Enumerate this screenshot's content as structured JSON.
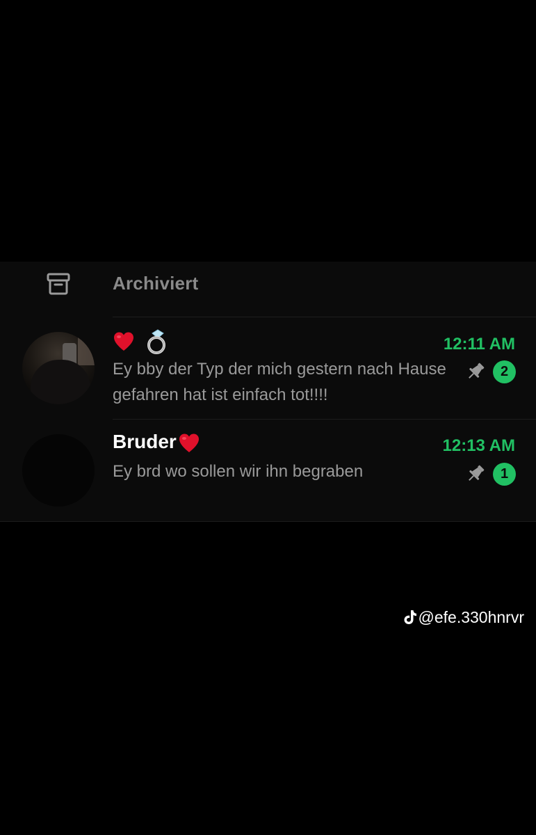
{
  "archived": {
    "label": "Archiviert",
    "icon": "archive-icon"
  },
  "chats": [
    {
      "name": "",
      "name_emojis": [
        "red-heart-emoji",
        "ring-emoji"
      ],
      "time": "12:11 AM",
      "preview": "Ey bby der Typ der mich gestern nach Hause gefahren hat ist einfach tot!!!!",
      "pinned": true,
      "unread": "2"
    },
    {
      "name": "Bruder",
      "name_emojis": [
        "red-heart-emoji"
      ],
      "time": "12:13 AM",
      "preview": "Ey brd wo sollen wir ihn begraben",
      "pinned": true,
      "unread": "1"
    }
  ],
  "watermark": {
    "handle": "@efe.330hnrvr",
    "icon": "tiktok-icon"
  },
  "colors": {
    "accent_green": "#21c063",
    "background": "#000000",
    "panel": "#0b0b0b",
    "secondary_text": "#9a9a9a"
  }
}
